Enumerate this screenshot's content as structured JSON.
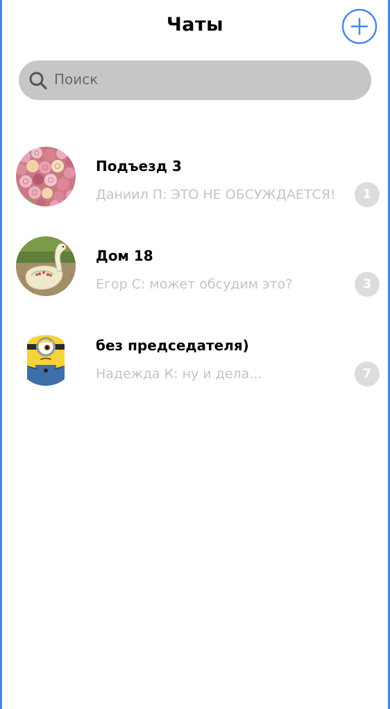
{
  "header": {
    "title": "Чаты",
    "add_icon": "plus-circle-icon"
  },
  "search": {
    "placeholder": "Поиск",
    "icon": "search-icon"
  },
  "chats": [
    {
      "name": "Подъезд 3",
      "preview": "Даниил П: ЭТО НЕ ОБСУЖДАЕТСЯ!",
      "unread": "1",
      "avatar": "roses-bouquet-photo"
    },
    {
      "name": "Дом 18",
      "preview": "Егор С: может обсудим это?",
      "unread": "3",
      "avatar": "tire-swan-planter-photo"
    },
    {
      "name": "без председателя)",
      "preview": "Надежда К:  ну и дела...",
      "unread": "7",
      "avatar": "minion-photo"
    }
  ],
  "colors": {
    "accent": "#4a86e8",
    "search_bg": "#c6c6c6",
    "preview_text": "#c4c4c4",
    "badge_bg": "#dcdcdc"
  }
}
